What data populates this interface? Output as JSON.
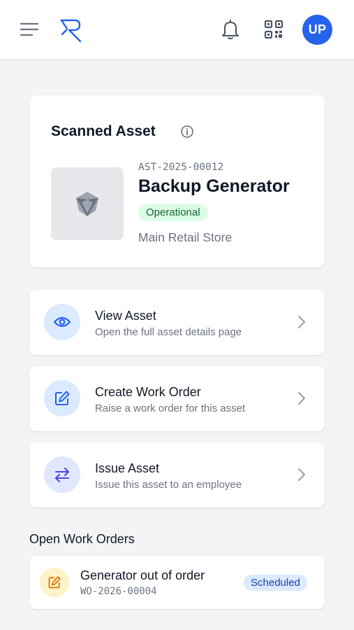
{
  "header": {
    "avatar_initials": "UP",
    "icons": [
      "menu-icon",
      "logo-icon",
      "bell-icon",
      "qr-code-icon"
    ],
    "colors": {
      "avatar_bg": "#2563eb",
      "logo": "#2563eb"
    }
  },
  "asset": {
    "section_title": "Scanned Asset",
    "code": "AST-2025-00012",
    "name": "Backup Generator",
    "status": "Operational",
    "location": "Main Retail Store",
    "colors": {
      "status_bg": "#dcfce7",
      "status_text": "#166534"
    }
  },
  "actions": [
    {
      "title": "View Asset",
      "subtitle": "Open the full asset details page",
      "icon": "eye-icon",
      "icon_bg": "#dbeafe",
      "icon_color": "#2563eb"
    },
    {
      "title": "Create Work Order",
      "subtitle": "Raise a work order for this asset",
      "icon": "edit-icon",
      "icon_bg": "#dbeafe",
      "icon_color": "#2563eb"
    },
    {
      "title": "Issue Asset",
      "subtitle": "Issue this asset to an employee",
      "icon": "swap-icon",
      "icon_bg": "#e0e7ff",
      "icon_color": "#4f46e5"
    }
  ],
  "open_work_orders": {
    "section_title": "Open Work Orders",
    "items": [
      {
        "title": "Generator out of order",
        "code": "WO-2026-00004",
        "status": "Scheduled",
        "icon": "edit-icon",
        "icon_bg": "#fef3c7",
        "icon_color": "#d97706",
        "status_bg": "#dbeafe",
        "status_text": "#1e40af"
      }
    ]
  }
}
